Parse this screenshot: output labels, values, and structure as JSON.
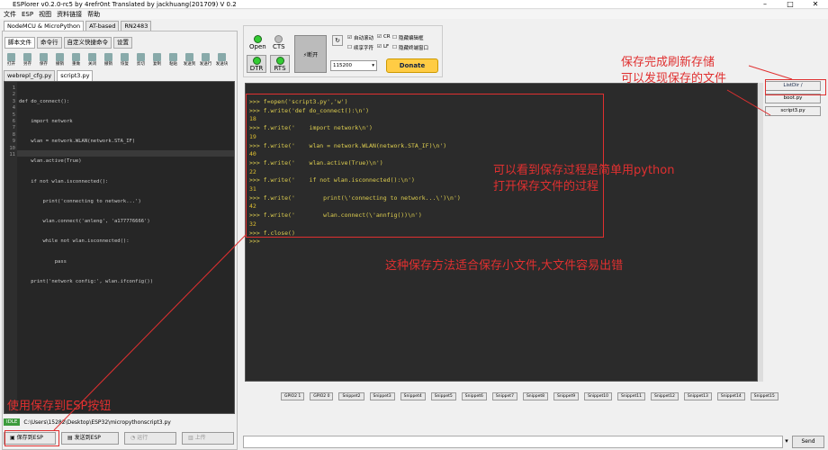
{
  "window": {
    "title": "ESPlorer v0.2.0-rc5 by 4refr0nt Translated by jackhuang(201709) V 0.2"
  },
  "menu": [
    "文件",
    "ESP",
    "视图",
    "资料链接",
    "帮助"
  ],
  "top_tabs": [
    "NodeMCU & MicroPython",
    "AT-based",
    "RN2483"
  ],
  "sub_tabs": [
    "脚本文件",
    "命令行",
    "自定义快捷命令",
    "设置"
  ],
  "toolbar": [
    "打开",
    "另存",
    "保存",
    "撤销",
    "重做",
    "关闭",
    "撤销",
    "恢复",
    "剪切",
    "复制",
    "粘贴",
    "发送到",
    "发送行",
    "发送块"
  ],
  "file_tabs": [
    "webrepl_cfg.py",
    "script3.py"
  ],
  "editor": {
    "line_numbers": [
      "1",
      "2",
      "3",
      "4",
      "5",
      "6",
      "7",
      "8",
      "9",
      "10",
      "11"
    ],
    "lines": [
      "def do_connect():",
      "    import network",
      "    wlan = network.WLAN(network.STA_IF)",
      "    wlan.active(True)",
      "    if not wlan.isconnected():",
      "        print('connecting to network...')",
      "        wlan.connect('anleng', 'a177776666')",
      "        while not wlan.isconnected():",
      "            pass",
      "    print('network config:', wlan.ifconfig())",
      ""
    ]
  },
  "status": {
    "badge": "IDLE",
    "path": "C:\\Users\\15282\\Desktop\\ESP32\\micropythonscript3.py"
  },
  "bottom_buttons": [
    "保存到ESP",
    "发送到ESP",
    "运行",
    "上传"
  ],
  "controls": {
    "open": "Open",
    "cts": "CTS",
    "dtr": "DTR",
    "rts": "RTS",
    "disconnect": "断开",
    "autoscroll": "自动滚动",
    "linebreak": "续享字符",
    "hide_editor": "隐藏编辑框",
    "hide_terminal": "隐藏终端窗口",
    "cr": "CR",
    "lf": "LF",
    "baud": "115200",
    "donate": "Donate"
  },
  "terminal": [
    {
      "t": "p",
      "v": ">>> f=open('script3.py','w')"
    },
    {
      "t": "p",
      "v": ">>> f.write('def do_connect():\\n')"
    },
    {
      "t": "n",
      "v": "18"
    },
    {
      "t": "p",
      "v": ">>> f.write('    import network\\n')"
    },
    {
      "t": "n",
      "v": "19"
    },
    {
      "t": "p",
      "v": ">>> f.write('    wlan = network.WLAN(network.STA_IF)\\n')"
    },
    {
      "t": "n",
      "v": "40"
    },
    {
      "t": "p",
      "v": ">>> f.write('    wlan.active(True)\\n')"
    },
    {
      "t": "n",
      "v": "22"
    },
    {
      "t": "p",
      "v": ">>> f.write('    if not wlan.isconnected():\\n')"
    },
    {
      "t": "n",
      "v": "31"
    },
    {
      "t": "p",
      "v": ">>> f.write('        print(\\'connecting to network...\\')\\n')"
    },
    {
      "t": "n",
      "v": "42"
    },
    {
      "t": "p",
      "v": ">>> f.write('        wlan.connect(\\'annfig())\\n')"
    },
    {
      "t": "n",
      "v": "32"
    },
    {
      "t": "p",
      "v": ">>> f.close()"
    },
    {
      "t": "p",
      "v": ">>>"
    }
  ],
  "sidebar": [
    "ListDir /",
    "boot.py",
    "script3.py"
  ],
  "snippets": [
    "GPIO2 1",
    "GPIO2 0",
    "Snippet2",
    "Snippet3",
    "Snippet4",
    "Snippet5",
    "Snippet6",
    "Snippet7",
    "Snippet8",
    "Snippet9",
    "Snippet10",
    "Snippet11",
    "Snippet12",
    "Snippet13",
    "Snippet14",
    "Snippet15"
  ],
  "send_button": "Send",
  "annotations": {
    "save_refresh_1": "保存完成刷新存储",
    "save_refresh_2": "可以发现保存的文件",
    "process_1": "可以看到保存过程是简单用python",
    "process_2": "打开保存文件的过程",
    "note": "这种保存方法适合保存小文件,大文件容易出错",
    "use_save": "使用保存到ESP按钮"
  },
  "colors": {
    "accent_red": "#e03030",
    "terminal_bg": "#2b2b2b",
    "editor_bg": "#262626"
  }
}
